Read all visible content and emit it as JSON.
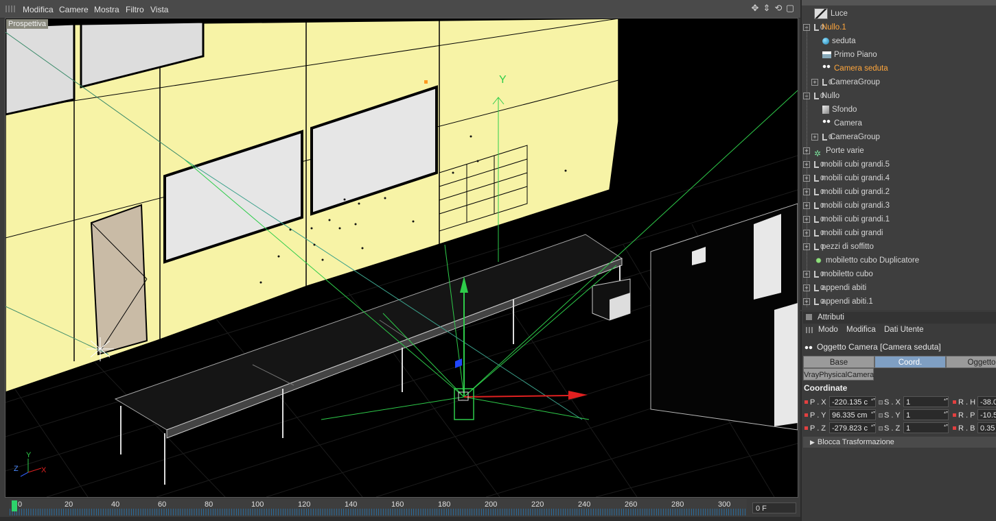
{
  "viewport_menu": [
    "Modifica",
    "Camere",
    "Mostra",
    "Filtro",
    "Vista"
  ],
  "viewport_label": "Prospettiva",
  "axis_labels": {
    "y_gizmo": "Y",
    "corner_y": "Y",
    "corner_z": "Z",
    "corner_x": "X"
  },
  "timeline": {
    "ticks": [
      "0",
      "20",
      "40",
      "60",
      "80",
      "100",
      "120",
      "140",
      "160",
      "180",
      "200",
      "220",
      "240",
      "260",
      "280",
      "300"
    ],
    "current_frame": "0 F"
  },
  "object_tree": [
    {
      "label": "Luce",
      "icon": "light-icon",
      "depth": 0,
      "expand": "",
      "highlight": false
    },
    {
      "label": "Nullo.1",
      "icon": "null-icon",
      "depth": 0,
      "expand": "−",
      "highlight": true
    },
    {
      "label": "seduta",
      "icon": "sphere-icon",
      "depth": 1,
      "expand": "",
      "highlight": false
    },
    {
      "label": "Primo Piano",
      "icon": "floor-icon",
      "depth": 1,
      "expand": "",
      "highlight": false
    },
    {
      "label": "Camera seduta",
      "icon": "camera-icon",
      "depth": 1,
      "expand": "",
      "highlight": true
    },
    {
      "label": "CameraGroup",
      "icon": "null-icon",
      "depth": 1,
      "expand": "+",
      "highlight": false
    },
    {
      "label": "Nullo",
      "icon": "null-icon",
      "depth": 0,
      "expand": "−",
      "highlight": false
    },
    {
      "label": "Sfondo",
      "icon": "background-icon",
      "depth": 1,
      "expand": "",
      "highlight": false
    },
    {
      "label": "Camera",
      "icon": "camera-icon",
      "depth": 1,
      "expand": "",
      "highlight": false
    },
    {
      "label": "CameraGroup",
      "icon": "null-icon",
      "depth": 1,
      "expand": "+",
      "highlight": false
    },
    {
      "label": "Porte varie",
      "icon": "doors-icon",
      "depth": 0,
      "expand": "+",
      "highlight": false
    },
    {
      "label": "mobili cubi grandi.5",
      "icon": "null-icon",
      "depth": 0,
      "expand": "+",
      "highlight": false
    },
    {
      "label": "mobili cubi grandi.4",
      "icon": "null-icon",
      "depth": 0,
      "expand": "+",
      "highlight": false
    },
    {
      "label": "mobili cubi grandi.2",
      "icon": "null-icon",
      "depth": 0,
      "expand": "+",
      "highlight": false
    },
    {
      "label": "mobili cubi grandi.3",
      "icon": "null-icon",
      "depth": 0,
      "expand": "+",
      "highlight": false
    },
    {
      "label": "mobili cubi grandi.1",
      "icon": "null-icon",
      "depth": 0,
      "expand": "+",
      "highlight": false
    },
    {
      "label": "mobili cubi grandi",
      "icon": "null-icon",
      "depth": 0,
      "expand": "+",
      "highlight": false
    },
    {
      "label": "pezzi di soffitto",
      "icon": "null-icon",
      "depth": 0,
      "expand": "+",
      "highlight": false
    },
    {
      "label": "mobiletto cubo Duplicatore",
      "icon": "duplicator-icon",
      "depth": 0,
      "expand": "",
      "highlight": false
    },
    {
      "label": "mobiletto cubo",
      "icon": "null-icon",
      "depth": 0,
      "expand": "+",
      "highlight": false
    },
    {
      "label": "appendi abiti",
      "icon": "null-icon",
      "depth": 0,
      "expand": "+",
      "highlight": false
    },
    {
      "label": "appendi abiti.1",
      "icon": "null-icon",
      "depth": 0,
      "expand": "+",
      "highlight": false
    }
  ],
  "attributes": {
    "title": "Attributi",
    "menu": [
      "Modo",
      "Modifica",
      "Dati Utente"
    ],
    "object_name": "Oggetto Camera [Camera seduta]",
    "tabs": [
      "Base",
      "Coord.",
      "Oggetto"
    ],
    "active_tab": "Coord.",
    "tab_vray": "VrayPhysicalCamera",
    "section": "Coordinate",
    "position": {
      "x_label": "P . X",
      "x": "-220.135 c",
      "y_label": "P . Y",
      "y": "96.335 cm",
      "z_label": "P . Z",
      "z": "-279.823 c"
    },
    "scale": {
      "x_label": "S . X",
      "x": "1",
      "y_label": "S . Y",
      "y": "1",
      "z_label": "S . Z",
      "z": "1"
    },
    "rotation": {
      "h_label": "R . H",
      "h": "-38.0",
      "p_label": "R . P",
      "p": "-10.5",
      "b_label": "R . B",
      "b": "0.35"
    },
    "lock_transform": "Blocca Trasformazione"
  },
  "colors": {
    "wall": "#f7f3a6",
    "highlight_orange": "#ffa63c",
    "active_tab": "#7f9fc3",
    "gizmo_green": "#2ecc4a",
    "gizmo_red": "#e02020"
  }
}
